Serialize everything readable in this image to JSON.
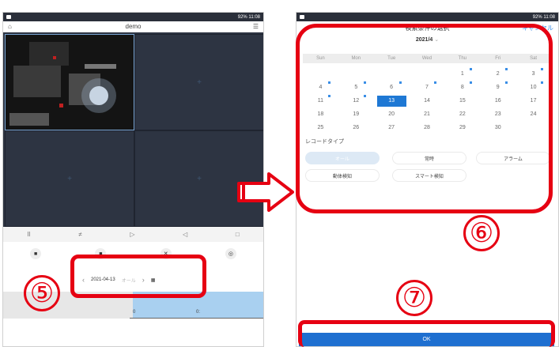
{
  "left_phone": {
    "status": {
      "right_text": "92% 11:08"
    },
    "nav": {
      "title": "demo",
      "home_icon": "home-icon",
      "menu_icon": "menu-icon"
    },
    "grid": {
      "add_symbol": "+"
    },
    "controls": {
      "pause": "II",
      "split": "≠",
      "play": "▷",
      "volume": "◁",
      "layout": "□"
    },
    "date_picker": {
      "date": "2021-04-13",
      "mode": "オール",
      "prev": "‹",
      "next": "›",
      "calendar_icon": "calendar-icon"
    },
    "timeline": {
      "tick1": "0",
      "tick2": "0:"
    }
  },
  "right_phone": {
    "status": {
      "right_text": "92% 11:08"
    },
    "nav": {
      "title": "検索条件の選択",
      "cancel": "キャンセル"
    },
    "month": "2021/4",
    "weekdays": [
      "Sun",
      "Mon",
      "Tue",
      "Wed",
      "Thu",
      "Fri",
      "Sat"
    ],
    "days": [
      {
        "d": "",
        "rec": false
      },
      {
        "d": "",
        "rec": false
      },
      {
        "d": "",
        "rec": false
      },
      {
        "d": "",
        "rec": false
      },
      {
        "d": "1",
        "rec": true
      },
      {
        "d": "2",
        "rec": true
      },
      {
        "d": "3",
        "rec": true
      },
      {
        "d": "4",
        "rec": true
      },
      {
        "d": "5",
        "rec": true
      },
      {
        "d": "6",
        "rec": true
      },
      {
        "d": "7",
        "rec": true
      },
      {
        "d": "8",
        "rec": true
      },
      {
        "d": "9",
        "rec": true
      },
      {
        "d": "10",
        "rec": true
      },
      {
        "d": "11",
        "rec": true
      },
      {
        "d": "12",
        "rec": true
      },
      {
        "d": "13",
        "rec": false,
        "sel": true
      },
      {
        "d": "14",
        "rec": false
      },
      {
        "d": "15",
        "rec": false
      },
      {
        "d": "16",
        "rec": false
      },
      {
        "d": "17",
        "rec": false
      },
      {
        "d": "18",
        "rec": false
      },
      {
        "d": "19",
        "rec": false
      },
      {
        "d": "20",
        "rec": false
      },
      {
        "d": "21",
        "rec": false
      },
      {
        "d": "22",
        "rec": false
      },
      {
        "d": "23",
        "rec": false
      },
      {
        "d": "24",
        "rec": false
      },
      {
        "d": "25",
        "rec": false
      },
      {
        "d": "26",
        "rec": false
      },
      {
        "d": "27",
        "rec": false
      },
      {
        "d": "28",
        "rec": false
      },
      {
        "d": "29",
        "rec": false
      },
      {
        "d": "30",
        "rec": false
      }
    ],
    "record_type_label": "レコードタイプ",
    "record_types": {
      "all": "オール",
      "regular": "常時",
      "alarm": "アラーム",
      "motion": "動体検知",
      "smart": "スマート検知"
    },
    "ok": "OK"
  },
  "annotations": {
    "n5": "⑤",
    "n6": "⑥",
    "n7": "⑦"
  },
  "colors": {
    "highlight": "#e60012",
    "accent": "#1e78d4",
    "grid_bg": "#2d3442",
    "timeline_fill": "#a9d0f0"
  }
}
